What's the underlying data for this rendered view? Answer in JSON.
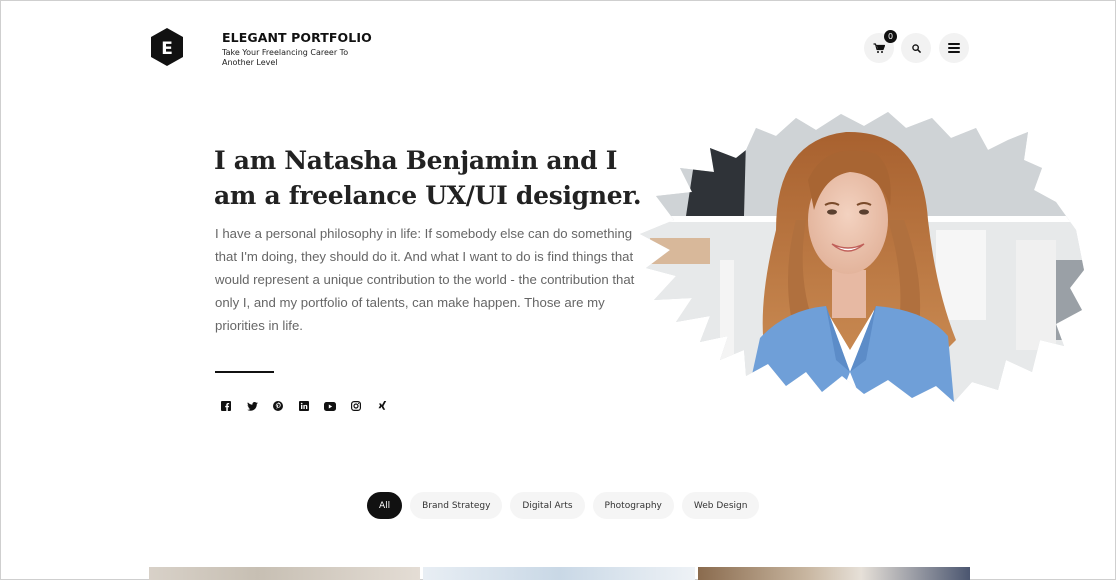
{
  "header": {
    "logo_letter": "E",
    "brand_title": "ELEGANT PORTFOLIO",
    "brand_tagline": "Take Your Freelancing Career To Another Level",
    "cart_count": "0",
    "icons": [
      "cart-icon",
      "search-icon",
      "menu-icon"
    ]
  },
  "hero": {
    "title": "I am Natasha Benjamin and I am a freelance UX/UI designer.",
    "description": "I have a personal philosophy in life: If somebody else can do something that I'm doing, they should do it. And what I want to do is find things that would represent a unique contribution to the world - the contribution that only I, and my portfolio of talents, can make happen. Those are my priorities in life.",
    "socials": [
      "facebook-icon",
      "twitter-icon",
      "pinterest-icon",
      "linkedin-icon",
      "youtube-icon",
      "instagram-icon",
      "xing-icon"
    ]
  },
  "filters": {
    "items": [
      {
        "label": "All",
        "active": true
      },
      {
        "label": "Brand Strategy",
        "active": false
      },
      {
        "label": "Digital Arts",
        "active": false
      },
      {
        "label": "Photography",
        "active": false
      },
      {
        "label": "Web Design",
        "active": false
      }
    ]
  },
  "colors": {
    "accent": "#111111",
    "text_muted": "#666666",
    "chip_bg": "#f5f5f5",
    "portrait_blazer": "#6f9fd8"
  }
}
